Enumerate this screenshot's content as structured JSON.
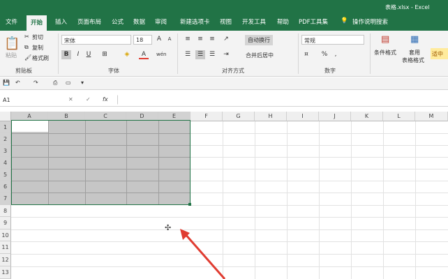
{
  "title": "表格.xlsx - Excel",
  "tabs": [
    "文件",
    "开始",
    "插入",
    "页面布局",
    "公式",
    "数据",
    "审阅",
    "新建选项卡",
    "视图",
    "开发工具",
    "帮助",
    "PDF工具集",
    "操作说明搜索"
  ],
  "clipboard": {
    "paste": "粘贴",
    "cut": "剪切",
    "copy": "复制",
    "painter": "格式刷",
    "group": "剪贴板"
  },
  "font": {
    "name": "宋体",
    "size": "18",
    "bold": "B",
    "italic": "I",
    "underline": "U",
    "grow": "A",
    "shrink": "A",
    "color_a": "A",
    "wen": "wén",
    "group": "字体"
  },
  "align": {
    "wrap": "自动换行",
    "merge": "合并后居中",
    "group": "对齐方式"
  },
  "number": {
    "format": "常规",
    "percent": "%",
    "comma": ",",
    "group": "数字"
  },
  "styles": {
    "conditional": "条件格式",
    "table": "套用",
    "table2": "表格格式",
    "cellstyle": "适中"
  },
  "formula": {
    "namebox": "A1",
    "cancel": "✕",
    "enter": "✓",
    "fx": "fx"
  },
  "columns": [
    "A",
    "B",
    "C",
    "D",
    "E",
    "F",
    "G",
    "H",
    "I",
    "J",
    "K",
    "L",
    "M"
  ],
  "rows": [
    "1",
    "2",
    "3",
    "4",
    "5",
    "6",
    "7",
    "8",
    "9",
    "10",
    "11",
    "12",
    "13"
  ],
  "colors": {
    "accent": "#217346",
    "arrow": "#e03c31",
    "selection": "#c6c6c6"
  }
}
